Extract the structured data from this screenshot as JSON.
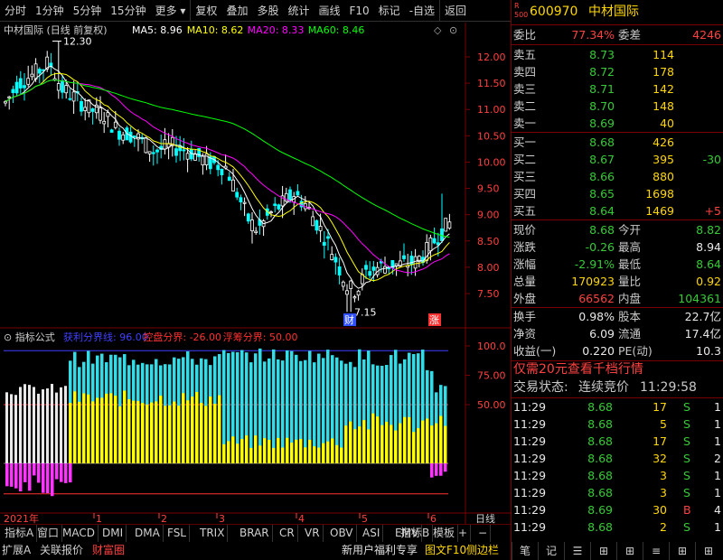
{
  "toolbar": {
    "items": [
      "分时",
      "1分钟",
      "5分钟",
      "15分钟",
      "更多",
      "复权",
      "叠加",
      "多股",
      "统计",
      "画线",
      "F10",
      "标记",
      "-自选",
      "返回"
    ]
  },
  "chart": {
    "title": "中材国际 (日线 前复权)",
    "ma_labels": [
      {
        "text": "MA5: 8.96",
        "color": "#ffffff"
      },
      {
        "text": "MA10: 8.62",
        "color": "#ffff00"
      },
      {
        "text": "MA20: 8.33",
        "color": "#ff00ff"
      },
      {
        "text": "MA60: 8.46",
        "color": "#00ff00"
      }
    ],
    "y_ticks": [
      "12.00",
      "11.50",
      "11.00",
      "10.50",
      "10.00",
      "9.50",
      "9.00",
      "8.50",
      "8.00",
      "7.50"
    ],
    "high_label": "12.30",
    "low_label": "7.15",
    "marker_cai": "财",
    "marker_zhang": "涨"
  },
  "indicator": {
    "name": "指标公式",
    "labels": [
      {
        "text": "获利分界线: 96.00",
        "color": "#4040ff"
      },
      {
        "text": "控盘分界: -26.00",
        "color": "#ff3030"
      },
      {
        "text": "浮筹分界: 50.00",
        "color": "#ff3030"
      }
    ],
    "y_ticks": [
      "100.0",
      "75.00",
      "50.00"
    ]
  },
  "timeline": {
    "year": "2021年",
    "months": [
      "1",
      "2",
      "3",
      "4",
      "5",
      "6"
    ],
    "period": "日线"
  },
  "indicator_tabs": [
    "指标A",
    "窗口",
    "MACD",
    "DMI",
    "DMA",
    "FSL",
    "TRIX",
    "BRAR",
    "CR",
    "VR",
    "OBV",
    "ASI",
    "EMV",
    "指标B",
    "模板",
    "+",
    "−"
  ],
  "bottom_bar": {
    "left": [
      "扩展A",
      "关联报价",
      "财富圈"
    ],
    "promo": "新用户福利专享",
    "f10": "图文F10",
    "sidebar": "侧边栏"
  },
  "bottom_icons": [
    "笔",
    "记",
    "☰",
    "⊞",
    "⊞",
    "≡",
    "⊞",
    "⊞"
  ],
  "quote": {
    "code": "600970",
    "name": "中材国际",
    "weibi_label": "委比",
    "weibi": "77.34%",
    "weicha_label": "委差",
    "weicha": "4246",
    "asks": [
      {
        "label": "卖五",
        "price": "8.73",
        "vol": "114",
        "chg": ""
      },
      {
        "label": "卖四",
        "price": "8.72",
        "vol": "178",
        "chg": ""
      },
      {
        "label": "卖三",
        "price": "8.71",
        "vol": "142",
        "chg": ""
      },
      {
        "label": "卖二",
        "price": "8.70",
        "vol": "148",
        "chg": ""
      },
      {
        "label": "卖一",
        "price": "8.69",
        "vol": "40",
        "chg": ""
      }
    ],
    "bids": [
      {
        "label": "买一",
        "price": "8.68",
        "vol": "426",
        "chg": ""
      },
      {
        "label": "买二",
        "price": "8.67",
        "vol": "395",
        "chg": "-30"
      },
      {
        "label": "买三",
        "price": "8.66",
        "vol": "880",
        "chg": ""
      },
      {
        "label": "买四",
        "price": "8.65",
        "vol": "1698",
        "chg": ""
      },
      {
        "label": "买五",
        "price": "8.64",
        "vol": "1469",
        "chg": "+5"
      }
    ],
    "stats": [
      {
        "l1": "现价",
        "v1": "8.68",
        "c1": "green",
        "l2": "今开",
        "v2": "8.82",
        "c2": "green"
      },
      {
        "l1": "涨跌",
        "v1": "-0.26",
        "c1": "green",
        "l2": "最高",
        "v2": "8.94",
        "c2": "white"
      },
      {
        "l1": "涨幅",
        "v1": "-2.91%",
        "c1": "green",
        "l2": "最低",
        "v2": "8.64",
        "c2": "green"
      },
      {
        "l1": "总量",
        "v1": "170923",
        "c1": "yellow",
        "l2": "量比",
        "v2": "0.92",
        "c2": "yellow"
      },
      {
        "l1": "外盘",
        "v1": "66562",
        "c1": "red",
        "l2": "内盘",
        "v2": "104361",
        "c2": "green"
      }
    ],
    "stats2": [
      {
        "l1": "换手",
        "v1": "0.98%",
        "l2": "股本",
        "v2": "22.7亿"
      },
      {
        "l1": "净资",
        "v1": "6.09",
        "l2": "流通",
        "v2": "17.4亿"
      },
      {
        "l1": "收益(一)",
        "v1": "0.220",
        "l2": "PE(动)",
        "v2": "10.3"
      }
    ],
    "promo": "仅需20元查看千档行情",
    "trade_status_label": "交易状态:",
    "trade_status": "连续竞价",
    "trade_time": "11:29:58",
    "ticks": [
      {
        "t": "11:29",
        "p": "8.68",
        "v": "17",
        "s": "S",
        "n": "1"
      },
      {
        "t": "11:29",
        "p": "8.68",
        "v": "5",
        "s": "S",
        "n": "1"
      },
      {
        "t": "11:29",
        "p": "8.68",
        "v": "17",
        "s": "S",
        "n": "1"
      },
      {
        "t": "11:29",
        "p": "8.68",
        "v": "32",
        "s": "S",
        "n": "2"
      },
      {
        "t": "11:29",
        "p": "8.68",
        "v": "3",
        "s": "S",
        "n": "1"
      },
      {
        "t": "11:29",
        "p": "8.68",
        "v": "3",
        "s": "S",
        "n": "1"
      },
      {
        "t": "11:29",
        "p": "8.69",
        "v": "30",
        "s": "B",
        "n": "4"
      },
      {
        "t": "11:29",
        "p": "8.68",
        "v": "2",
        "s": "S",
        "n": "1"
      }
    ]
  }
}
